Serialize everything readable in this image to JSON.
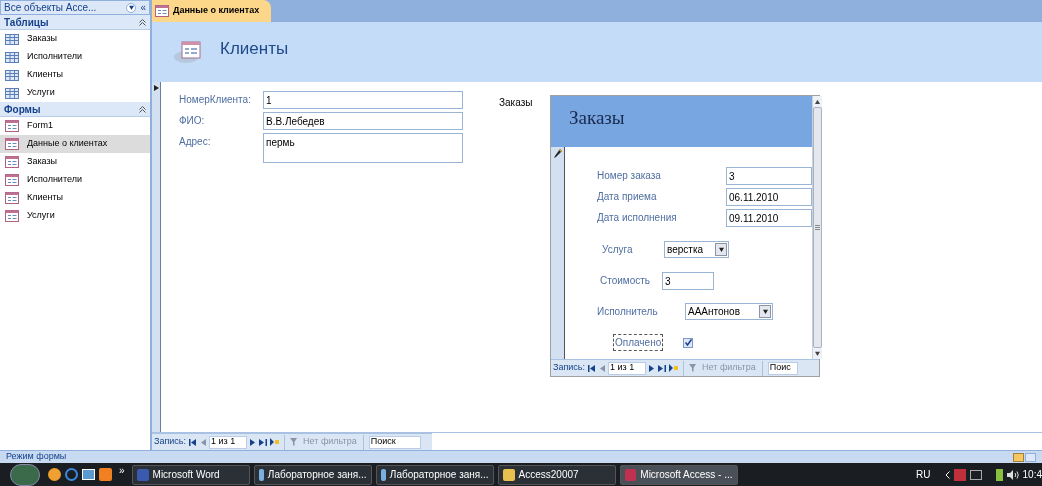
{
  "nav_pane": {
    "title": "Все объекты Acce...",
    "collapse": "«",
    "groups": [
      {
        "title": "Таблицы",
        "kind": "table",
        "expanded": true,
        "items": [
          {
            "label": "Заказы",
            "selected": false
          },
          {
            "label": "Исполнители",
            "selected": false
          },
          {
            "label": "Клиенты",
            "selected": false
          },
          {
            "label": "Услуги",
            "selected": false
          }
        ]
      },
      {
        "title": "Формы",
        "kind": "form",
        "expanded": true,
        "items": [
          {
            "label": "Form1",
            "selected": false
          },
          {
            "label": "Данные о клиентах",
            "selected": true
          },
          {
            "label": "Заказы",
            "selected": false
          },
          {
            "label": "Исполнители",
            "selected": false
          },
          {
            "label": "Клиенты",
            "selected": false
          },
          {
            "label": "Услуги",
            "selected": false
          }
        ]
      }
    ]
  },
  "document_tab": {
    "label": "Данные о клиентах",
    "selected": true
  },
  "form": {
    "title": "Клиенты",
    "fields": [
      {
        "kind": "text",
        "label": "НомерКлиента:",
        "value": "1"
      },
      {
        "kind": "text",
        "label": "ФИО:",
        "value": "В.В.Лебедев"
      },
      {
        "kind": "memo",
        "label": "Адрес:",
        "value": "пермь"
      }
    ],
    "subform_label": "Заказы",
    "subform": {
      "title": "Заказы",
      "fields": [
        {
          "kind": "text",
          "label": "Номер заказа",
          "value": "3"
        },
        {
          "kind": "text",
          "label": "Дата приема",
          "value": "06.11.2010"
        },
        {
          "kind": "text",
          "label": "Дата исполнения",
          "value": "09.11.2010"
        },
        {
          "kind": "combo",
          "label": "Услуга",
          "value": "верстка"
        },
        {
          "kind": "text",
          "label": "Стоимость",
          "value": "3"
        },
        {
          "kind": "combo",
          "label": "Исполнитель",
          "value": "АААнтонов"
        },
        {
          "kind": "checkbox",
          "label": "Оплачено",
          "checked": true
        }
      ],
      "record_nav": {
        "label": "Запись:",
        "position": "1 из 1",
        "filter": "Нет фильтра",
        "search": "Поис"
      }
    },
    "record_nav": {
      "label": "Запись:",
      "position": "1 из 1",
      "filter": "Нет фильтра",
      "search": "Поиск"
    }
  },
  "status_bar": {
    "text": "Режим формы"
  },
  "taskbar": {
    "more": "»",
    "buttons": [
      {
        "label": "Microsoft Word",
        "kind": "word",
        "selected": false
      },
      {
        "label": "Лабораторное заня...",
        "kind": "doc",
        "selected": false
      },
      {
        "label": "Лабораторное заня...",
        "kind": "doc",
        "selected": false
      },
      {
        "label": "Access20007",
        "kind": "folder",
        "selected": false
      },
      {
        "label": "Microsoft Access - ...",
        "kind": "access",
        "selected": true
      }
    ],
    "language": "RU",
    "clock": "10:4"
  }
}
